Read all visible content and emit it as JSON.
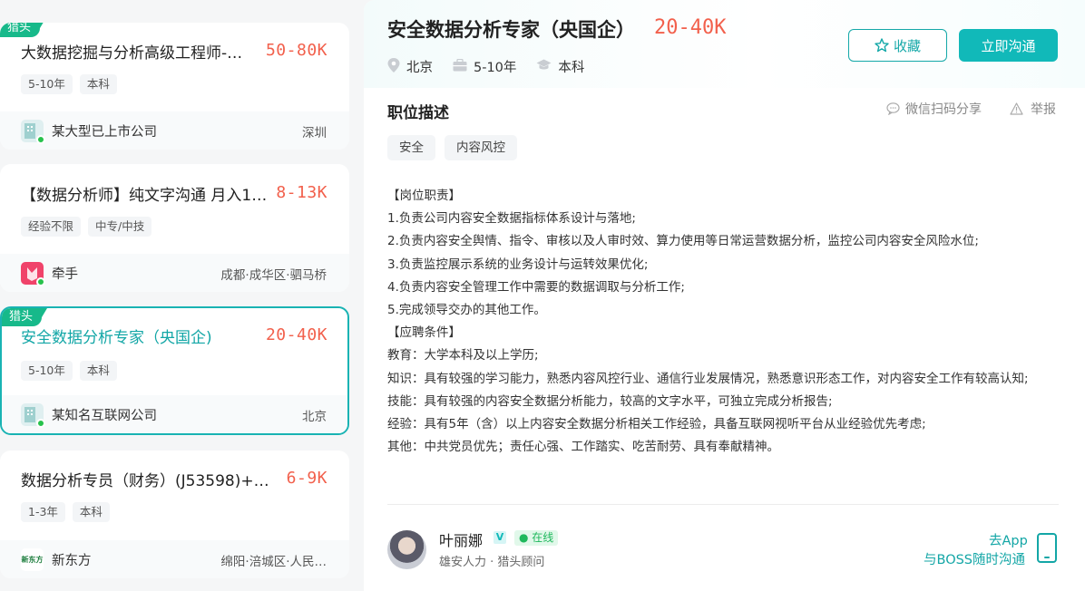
{
  "job_list": [
    {
      "badge": "猎头",
      "title": "大数据挖掘与分析高级工程师-安…",
      "salary": "50-80K",
      "tags": [
        "5-10年",
        "本科"
      ],
      "company": "某大型已上市公司",
      "location": "深圳",
      "logo_color": "#dfeff0"
    },
    {
      "badge": "",
      "title": "【数据分析师】纯文字沟通 月入1w+",
      "salary": "8-13K",
      "tags": [
        "经验不限",
        "中专/中技"
      ],
      "company": "牵手",
      "location": "成都·成华区·驷马桥",
      "logo_color": "#f0436a"
    },
    {
      "badge": "猎头",
      "title": "安全数据分析专家（央国企)",
      "salary": "20-40K",
      "tags": [
        "5-10年",
        "本科"
      ],
      "company": "某知名互联网公司",
      "location": "北京",
      "logo_color": "#dfeff0",
      "active": true
    },
    {
      "badge": "",
      "title": "数据分析专员（财务）(J53598)+周…",
      "salary": "6-9K",
      "tags": [
        "1-3年",
        "本科"
      ],
      "company": "新东方",
      "location": "绵阳·涪城区·人民…",
      "logo_color": "#ffffff",
      "logo_text": "新东方"
    }
  ],
  "detail": {
    "title": "安全数据分析专家（央国企）",
    "salary": "20-40K",
    "city": "北京",
    "experience": "5-10年",
    "degree": "本科",
    "favorite_label": "收藏",
    "chat_label": "立即沟通",
    "section_title": "职位描述",
    "share_label": "微信扫码分享",
    "report_label": "举报",
    "tags": [
      "安全",
      "内容风控"
    ],
    "description": [
      "【岗位职责】",
      "1.负责公司内容安全数据指标体系设计与落地;",
      "2.负责内容安全舆情、指令、审核以及人审时效、算力使用等日常运营数据分析，监控公司内容安全风险水位;",
      "3.负责监控展示系统的业务设计与运转效果优化;",
      "4.负责内容安全管理工作中需要的数据调取与分析工作;",
      "5.完成领导交办的其他工作。",
      "【应聘条件】",
      "教育：大学本科及以上学历;",
      "知识：具有较强的学习能力，熟悉内容风控行业、通信行业发展情况，熟悉意识形态工作，对内容安全工作有较高认知;",
      "技能：具有较强的内容安全数据分析能力，较高的文字水平，可独立完成分析报告;",
      "经验：具有5年（含）以上内容安全数据分析相关工作经验，具备互联网视听平台从业经验优先考虑;",
      "其他：中共党员优先；责任心强、工作踏实、吃苦耐劳、具有奉献精神。"
    ],
    "recruiter": {
      "name": "叶丽娜",
      "verified": "V",
      "status": "在线",
      "subtitle": "雄安人力 · 猎头顾问"
    },
    "app_line1": "去App",
    "app_line2": "与BOSS随时沟通"
  },
  "colors": {
    "accent": "#11b9b9",
    "salary": "#f2604c",
    "headhunter_badge": "#17b98a",
    "online_dot": "#27c24c"
  }
}
